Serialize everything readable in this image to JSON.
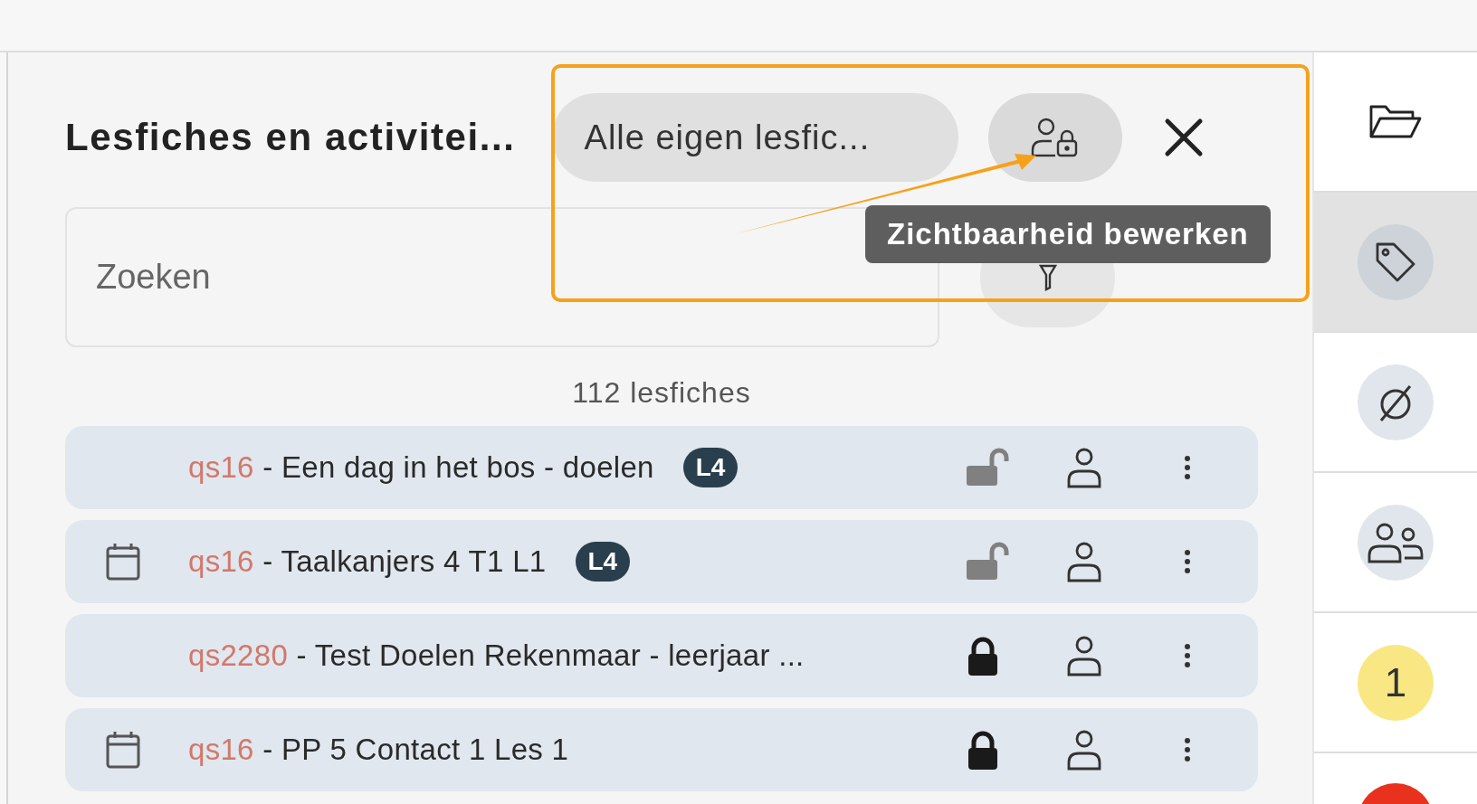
{
  "panel": {
    "title": "Lesfiches en activitei...",
    "filter": {
      "value": "Alle eigen lesfic..."
    },
    "tooltip": "Zichtbaarheid bewerken",
    "search": {
      "placeholder": "Zoeken"
    },
    "count": "112 lesfiches"
  },
  "rows": [
    {
      "code": "qs16",
      "title": "- Een dag in het bos - doelen",
      "badge": "L4",
      "scheduled": false,
      "locked": false
    },
    {
      "code": "qs16",
      "title": "- Taalkanjers 4 T1 L1",
      "badge": "L4",
      "scheduled": true,
      "locked": false
    },
    {
      "code": "qs2280",
      "title": "- Test Doelen Rekenmaar - leerjaar ...",
      "scheduled": false,
      "locked": true
    },
    {
      "code": "qs16",
      "title": "- PP 5 Contact 1 Les 1",
      "scheduled": true,
      "locked": true
    }
  ],
  "sidebar": {
    "items": [
      {
        "kind": "folder",
        "selected": false
      },
      {
        "kind": "tag",
        "selected": true
      },
      {
        "kind": "none",
        "selected": false
      },
      {
        "kind": "group",
        "selected": false
      },
      {
        "kind": "count",
        "label": "1",
        "color": "#f9e784",
        "selected": false
      },
      {
        "kind": "dot",
        "color": "#e8321e",
        "selected": false
      }
    ]
  }
}
